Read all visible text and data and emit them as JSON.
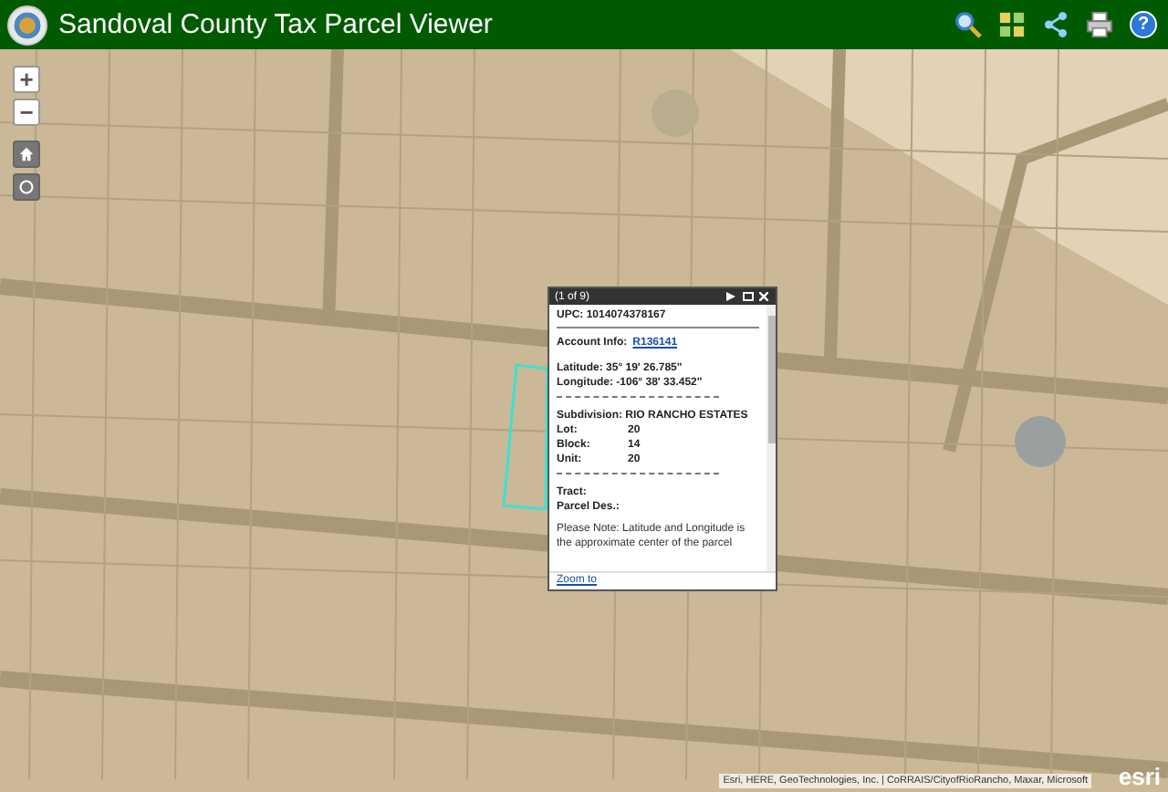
{
  "header": {
    "title": "Sandoval County Tax Parcel Viewer",
    "tools": [
      {
        "kind": "search"
      },
      {
        "kind": "layers"
      },
      {
        "kind": "share"
      },
      {
        "kind": "print"
      },
      {
        "kind": "help",
        "label": "?"
      }
    ]
  },
  "map_controls": [
    {
      "kind": "zoom_in",
      "label": "+"
    },
    {
      "kind": "zoom_out",
      "label": "−"
    },
    {
      "kind": "home"
    },
    {
      "kind": "locate"
    }
  ],
  "popup": {
    "counter": "(1 of 9)",
    "upc": {
      "label": "UPC:",
      "value": "1014074378167"
    },
    "account": {
      "label": "Account Info:",
      "link": "R136141"
    },
    "latitude": {
      "label": "Latitude:",
      "value": "35° 19' 26.785\""
    },
    "longitude": {
      "label": "Longitude:",
      "value": "-106° 38' 33.452\""
    },
    "subdivision": {
      "label": "Subdivision:",
      "value": "RIO RANCHO ESTATES"
    },
    "lot_rows": [
      {
        "label": "Lot:",
        "value": "20"
      },
      {
        "label": "Block:",
        "value": "14"
      },
      {
        "label": "Unit:",
        "value": "20"
      }
    ],
    "tract": {
      "label": "Tract:"
    },
    "parcel_des": {
      "label": "Parcel Des.:"
    },
    "note": "Please Note: Latitude and Longitude is the approximate center of the parcel",
    "zoom_link": "Zoom to"
  },
  "attribution": "Esri, HERE, GeoTechnologies, Inc. | CoRRAIS/CityofRioRancho, Maxar, Microsoft",
  "esri_logo": "esri"
}
